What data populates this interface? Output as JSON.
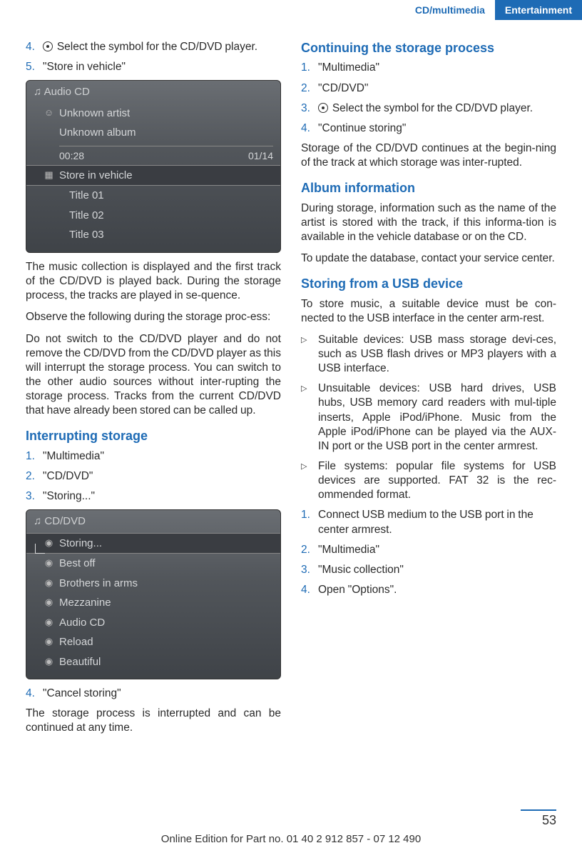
{
  "tabs": {
    "left": "CD/multimedia",
    "right": "Entertainment"
  },
  "left": {
    "steps_a": [
      {
        "n": "4.",
        "icon": true,
        "t": "Select the symbol for the CD/DVD player."
      },
      {
        "n": "5.",
        "t": "\"Store in vehicle\""
      }
    ],
    "ss1": {
      "header": "Audio CD",
      "r1": "Unknown artist",
      "r2": "Unknown album",
      "time_l": "00:28",
      "time_r": "01/14",
      "sel": "Store in vehicle",
      "t1": "Title  01",
      "t2": "Title  02",
      "t3": "Title  03"
    },
    "p1": "The music collection is displayed and the first track of the CD/DVD is played back. During the storage process, the tracks are played in se‐quence.",
    "p2": "Observe the following during the storage proc‐ess:",
    "p3": "Do not switch to the CD/DVD player and do not remove the CD/DVD from the CD/DVD player as this will interrupt the storage process. You can switch to the other audio sources without inter‐rupting the storage process. Tracks from the current CD/DVD that have already been stored can be called up.",
    "h1": "Interrupting storage",
    "steps_b": [
      {
        "n": "1.",
        "t": "\"Multimedia\""
      },
      {
        "n": "2.",
        "t": "\"CD/DVD\""
      },
      {
        "n": "3.",
        "t": "\"Storing...\""
      }
    ],
    "ss2": {
      "header": "CD/DVD",
      "sel": "Storing...",
      "r1": "Best off",
      "r2": "Brothers in arms",
      "r3": "Mezzanine",
      "r4": "Audio CD",
      "r5": "Reload",
      "r6": "Beautiful"
    },
    "steps_c": [
      {
        "n": "4.",
        "t": "\"Cancel storing\""
      }
    ],
    "p4": "The storage process is interrupted and can be continued at any time."
  },
  "right": {
    "h1": "Continuing the storage process",
    "steps_a": [
      {
        "n": "1.",
        "t": "\"Multimedia\""
      },
      {
        "n": "2.",
        "t": "\"CD/DVD\""
      },
      {
        "n": "3.",
        "icon": true,
        "t": "Select the symbol for the CD/DVD player."
      },
      {
        "n": "4.",
        "t": "\"Continue storing\""
      }
    ],
    "p1": "Storage of the CD/DVD continues at the begin‐ning of the track at which storage was inter‐rupted.",
    "h2": "Album information",
    "p2": "During storage, information such as the name of the artist is stored with the track, if this informa‐tion is available in the vehicle database or on the CD.",
    "p3": "To update the database, contact your service center.",
    "h3": "Storing from a USB device",
    "p4": "To store music, a suitable device must be con‐nected to the USB interface in the center arm‐rest.",
    "bullets": [
      "Suitable devices: USB mass storage devi‐ces, such as USB flash drives or MP3 players with a USB interface.",
      "Unsuitable devices: USB hard drives, USB hubs, USB memory card readers with mul‐tiple inserts, Apple iPod/iPhone. Music from the Apple iPod/iPhone can be played via the AUX-IN port or the USB port in the center armrest.",
      "File systems: popular file systems for USB devices are supported. FAT 32 is the rec‐ommended format."
    ],
    "steps_b": [
      {
        "n": "1.",
        "t": "Connect USB medium to the USB port in the center armrest."
      },
      {
        "n": "2.",
        "t": "\"Multimedia\""
      },
      {
        "n": "3.",
        "t": "\"Music collection\""
      },
      {
        "n": "4.",
        "t": "Open \"Options\"."
      }
    ]
  },
  "page": "53",
  "footer": "Online Edition for Part no. 01 40 2 912 857 - 07 12 490"
}
